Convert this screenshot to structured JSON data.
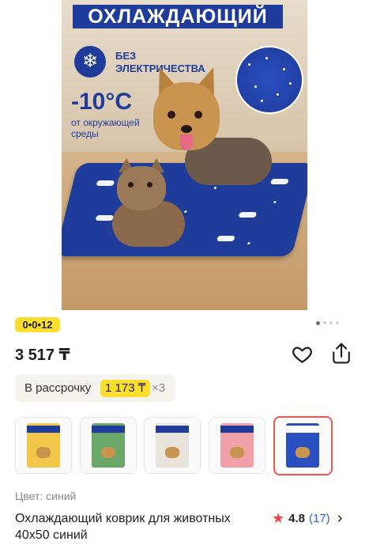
{
  "hero": {
    "banner_text": "ОХЛАЖДАЮЩИЙ",
    "no_electricity_line1": "БЕЗ",
    "no_electricity_line2": "ЭЛЕКТРИЧЕСТВА",
    "temperature": "-10°C",
    "temperature_note": "от окружающей среды",
    "snowflake_glyph": "❄"
  },
  "promo_badge": "0•0•12",
  "gallery_pager": {
    "total": 4,
    "active_index": 0
  },
  "price": "3 517 ₸",
  "installment": {
    "label": "В рассрочку",
    "amount": "1 173 ₸",
    "multiplier": "×3"
  },
  "color_variants": [
    {
      "name": "yellow",
      "accent": "#f3c74a"
    },
    {
      "name": "green",
      "accent": "#6aa86a"
    },
    {
      "name": "white",
      "accent": "#e8e4dc"
    },
    {
      "name": "pink",
      "accent": "#f2a0a8"
    },
    {
      "name": "blue",
      "accent": "#1f3c9a",
      "selected": true
    }
  ],
  "color_label": "Цвет: синий",
  "product_title": "Охлаждающий коврик для животных 40x50 синий",
  "rating": {
    "value": "4.8",
    "count": "(17)"
  },
  "icons": {
    "favorite": "heart-icon",
    "share": "share-icon",
    "rating": "star-icon",
    "reviews": "chevron-right-icon"
  },
  "colors": {
    "brand_blue": "#1f3c9a",
    "badge_yellow": "#ffde2e",
    "selected_border": "#e85a52",
    "link_blue": "#2a66d8",
    "star_red": "#f1433b"
  }
}
